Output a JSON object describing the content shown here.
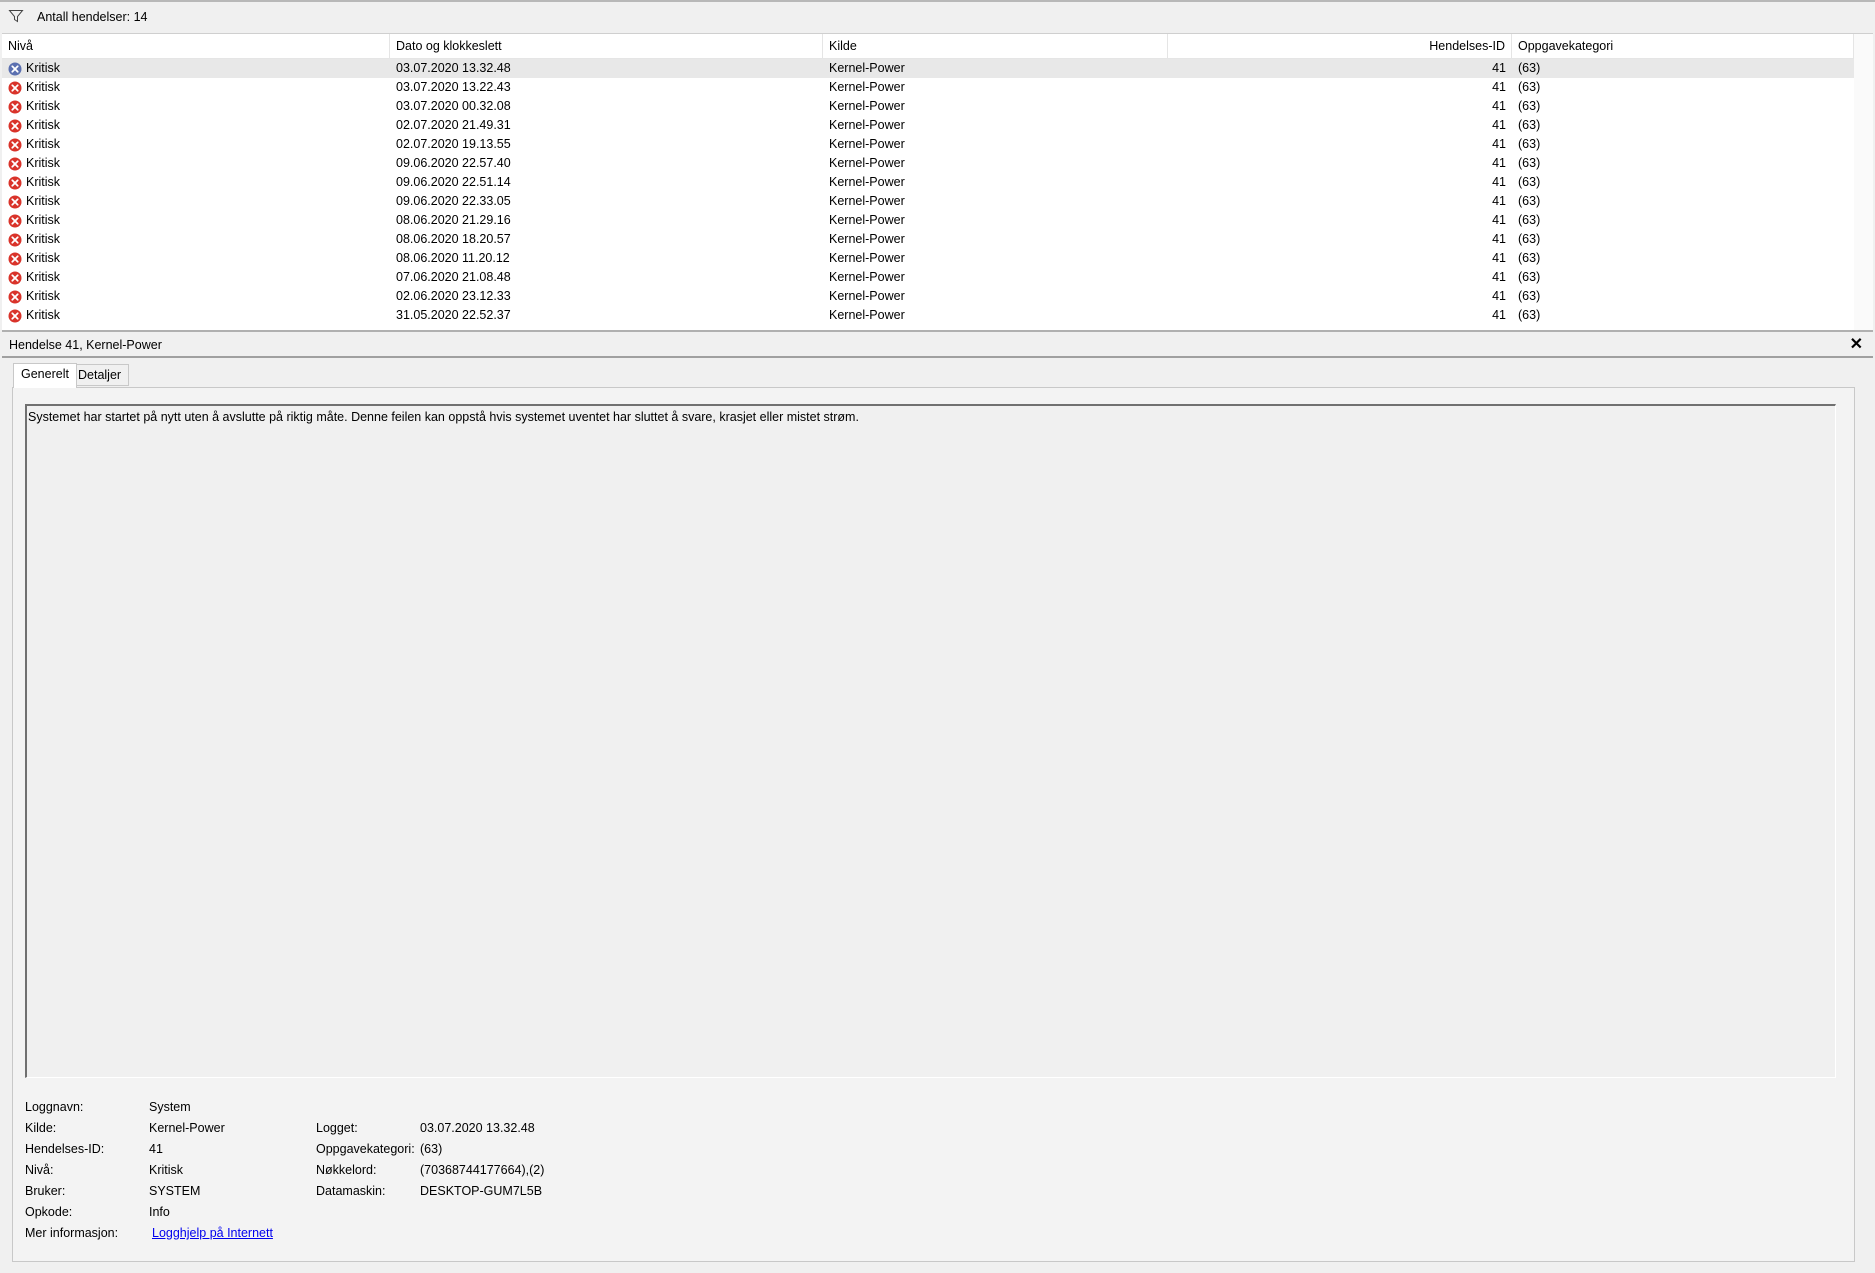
{
  "toolbar": {
    "filter_icon": "filter-funnel-icon",
    "event_count": "Antall hendelser: 14"
  },
  "list": {
    "columns": {
      "level": "Nivå",
      "datetime": "Dato og klokkeslett",
      "source": "Kilde",
      "event_id": "Hendelses-ID",
      "task_category": "Oppgavekategori"
    },
    "rows": [
      {
        "level": "Kritisk",
        "datetime": "03.07.2020 13.32.48",
        "source": "Kernel-Power",
        "event_id": "41",
        "category": "(63)"
      },
      {
        "level": "Kritisk",
        "datetime": "03.07.2020 13.22.43",
        "source": "Kernel-Power",
        "event_id": "41",
        "category": "(63)"
      },
      {
        "level": "Kritisk",
        "datetime": "03.07.2020 00.32.08",
        "source": "Kernel-Power",
        "event_id": "41",
        "category": "(63)"
      },
      {
        "level": "Kritisk",
        "datetime": "02.07.2020 21.49.31",
        "source": "Kernel-Power",
        "event_id": "41",
        "category": "(63)"
      },
      {
        "level": "Kritisk",
        "datetime": "02.07.2020 19.13.55",
        "source": "Kernel-Power",
        "event_id": "41",
        "category": "(63)"
      },
      {
        "level": "Kritisk",
        "datetime": "09.06.2020 22.57.40",
        "source": "Kernel-Power",
        "event_id": "41",
        "category": "(63)"
      },
      {
        "level": "Kritisk",
        "datetime": "09.06.2020 22.51.14",
        "source": "Kernel-Power",
        "event_id": "41",
        "category": "(63)"
      },
      {
        "level": "Kritisk",
        "datetime": "09.06.2020 22.33.05",
        "source": "Kernel-Power",
        "event_id": "41",
        "category": "(63)"
      },
      {
        "level": "Kritisk",
        "datetime": "08.06.2020 21.29.16",
        "source": "Kernel-Power",
        "event_id": "41",
        "category": "(63)"
      },
      {
        "level": "Kritisk",
        "datetime": "08.06.2020 18.20.57",
        "source": "Kernel-Power",
        "event_id": "41",
        "category": "(63)"
      },
      {
        "level": "Kritisk",
        "datetime": "08.06.2020 11.20.12",
        "source": "Kernel-Power",
        "event_id": "41",
        "category": "(63)"
      },
      {
        "level": "Kritisk",
        "datetime": "07.06.2020 21.08.48",
        "source": "Kernel-Power",
        "event_id": "41",
        "category": "(63)"
      },
      {
        "level": "Kritisk",
        "datetime": "02.06.2020 23.12.33",
        "source": "Kernel-Power",
        "event_id": "41",
        "category": "(63)"
      },
      {
        "level": "Kritisk",
        "datetime": "31.05.2020 22.52.37",
        "source": "Kernel-Power",
        "event_id": "41",
        "category": "(63)"
      }
    ],
    "selected_index": 0,
    "critical_icon_color": "#d9332a",
    "selected_icon_color": "#5a6fb0"
  },
  "detail": {
    "title": "Hendelse 41, Kernel-Power",
    "close_glyph": "✕",
    "tabs": {
      "general": "Generelt",
      "details": "Detaljer"
    },
    "description": "Systemet har startet på nytt uten å avslutte på riktig måte. Denne feilen kan oppstå hvis systemet uventet har sluttet å svare, krasjet eller mistet strøm.",
    "props": {
      "log_name_label": "Loggnavn:",
      "log_name": "System",
      "source_label": "Kilde:",
      "source": "Kernel-Power",
      "event_id_label": "Hendelses-ID:",
      "event_id": "41",
      "level_label": "Nivå:",
      "level": "Kritisk",
      "user_label": "Bruker:",
      "user": "SYSTEM",
      "opcode_label": "Opkode:",
      "opcode": "Info",
      "more_info_label": "Mer informasjon:",
      "more_info_link": "Logghjelp på Internett",
      "logged_label": "Logget:",
      "logged": "03.07.2020 13.32.48",
      "task_category_label": "Oppgavekategori:",
      "task_category": "(63)",
      "keywords_label": "Nøkkelord:",
      "keywords": "(70368744177664),(2)",
      "computer_label": "Datamaskin:",
      "computer": "DESKTOP-GUM7L5B"
    }
  }
}
